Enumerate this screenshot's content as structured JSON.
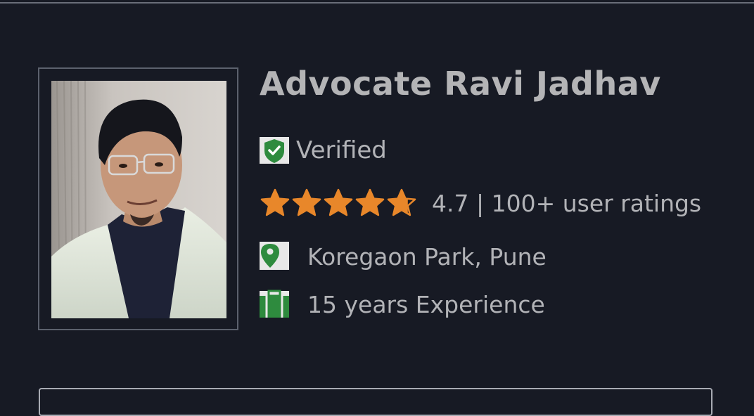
{
  "profile": {
    "name": "Advocate Ravi Jadhav",
    "verified_label": "Verified",
    "rating": {
      "value": 4.7,
      "max": 5,
      "text": "4.7 | 100+ user ratings"
    },
    "location": "Koregaon Park, Pune",
    "experience": "15 years Experience"
  },
  "icons": {
    "verified": "shield-check-icon",
    "star": "star-icon",
    "location": "map-pin-icon",
    "experience": "briefcase-icon"
  },
  "colors": {
    "background": "#171a24",
    "text": "#b2b3b7",
    "star": "#e8872a",
    "icon_green": "#2e8b3e"
  }
}
